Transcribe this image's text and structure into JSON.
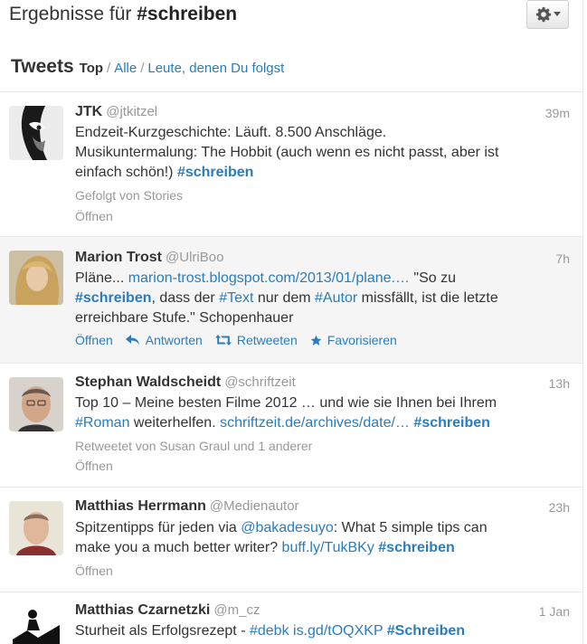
{
  "header": {
    "title_prefix": "Ergebnisse für ",
    "title_query": "#schreiben",
    "settings_icon": "gear-icon"
  },
  "filter": {
    "heading": "Tweets",
    "active": "Top",
    "sep1": "/",
    "alle": "Alle",
    "sep2": "/",
    "following": "Leute, denen Du folgst"
  },
  "tweets": [
    {
      "name": "JTK",
      "username": "@jtkitzel",
      "time": "39m",
      "line1": "Endzeit-Kurzgeschichte: Läuft. 8.500 Anschläge.",
      "line2": "Musikuntermalung: The Hobbit (auch wenn es nicht passt, aber ist",
      "line3": "einfach schön!) ",
      "hashtag": "#schreiben",
      "meta": "Gefolgt von Stories",
      "open": "Öffnen"
    },
    {
      "name": "Marion Trost",
      "username": "@UlriBoo",
      "time": "7h",
      "a1": "Pläne... ",
      "link": "marion-trost.blogspot.com/2013/01/plane.…",
      "a2": " \"So zu",
      "h1": "#schreiben",
      "b1": ", dass der ",
      "h2": "#Text",
      "b2": " nur dem ",
      "h3": "#Autor",
      "b3": " missfällt, ist die letzte",
      "line3": "erreichbare Stufe.\" Schopenhauer",
      "actions": {
        "open": "Öffnen",
        "reply": "Antworten",
        "retweet": "Retweeten",
        "favorite": "Favorisieren"
      }
    },
    {
      "name": "Stephan Waldscheidt",
      "username": "@schriftzeit",
      "time": "13h",
      "line1": "Top 10 – Meine besten Filme 2012 … und wie sie Ihnen bei Ihrem",
      "h1": "#Roman",
      "b1": " weiterhelfen. ",
      "link": "schriftzeit.de/archives/date/…",
      "b2": " ",
      "h2": "#schreiben",
      "meta": "Retweetet von Susan Graul und 1 anderer",
      "open": "Öffnen"
    },
    {
      "name": "Matthias Herrmann",
      "username": "@Medienautor",
      "time": "23h",
      "a1": "Spitzentipps für jeden via ",
      "mention": "@bakadesuyo",
      "a2": ": What 5 simple tips can",
      "b1": "make you a much better writer? ",
      "link": "buff.ly/TukBKy",
      "b2": " ",
      "h1": "#schreiben",
      "open": "Öffnen"
    },
    {
      "name": "Matthias Czarnetzki",
      "username": "@m_cz",
      "time": "1 Jan",
      "a1": "Sturheit als Erfolgsrezept - ",
      "h1": "#debk",
      "a2": " ",
      "link": "is.gd/tOQXKP",
      "a3": " ",
      "h2": "#Schreiben"
    }
  ],
  "colors": {
    "link": "#2a7cbd",
    "muted": "#999999",
    "highlight_bg": "#f5f5f5"
  }
}
